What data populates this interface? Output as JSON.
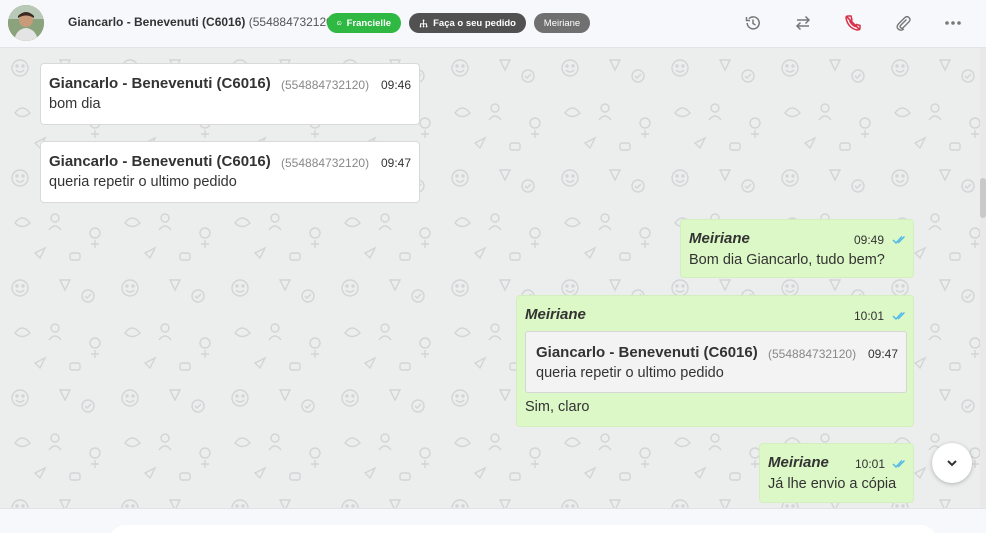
{
  "header": {
    "contact_name": "Giancarlo - Benevenuti (C6016)",
    "contact_phone": "(554884732120)",
    "tag_whatsapp": "Francielle",
    "tag_order": "Faça o seu pedido",
    "tag_agent": "Meiriane",
    "icons": [
      "history-icon",
      "transfer-icon",
      "end-call-icon",
      "attach-icon",
      "more-icon"
    ]
  },
  "messages": [
    {
      "direction": "in",
      "sender": "Giancarlo - Benevenuti (C6016)",
      "phone": "(554884732120)",
      "time": "09:46",
      "text": "bom dia"
    },
    {
      "direction": "in",
      "sender": "Giancarlo - Benevenuti (C6016)",
      "phone": "(554884732120)",
      "time": "09:47",
      "text": "queria repetir o ultimo pedido"
    },
    {
      "direction": "out",
      "sender": "Meiriane",
      "time": "09:49",
      "text": "Bom dia Giancarlo, tudo bem?"
    },
    {
      "direction": "out",
      "sender": "Meiriane",
      "time": "10:01",
      "text": "Sim, claro",
      "quoted": {
        "sender": "Giancarlo - Benevenuti (C6016)",
        "phone": "(554884732120)",
        "time": "09:47",
        "text": "queria repetir o ultimo pedido"
      }
    },
    {
      "direction": "out",
      "sender": "Meiriane",
      "time": "10:01",
      "text": "Já lhe envio a cópia"
    }
  ],
  "colors": {
    "whatsapp_green": "#2fb842",
    "outgoing_bubble": "#dcf8c6",
    "read_ticks": "#4fb6ec",
    "end_call": "#d9304a"
  }
}
